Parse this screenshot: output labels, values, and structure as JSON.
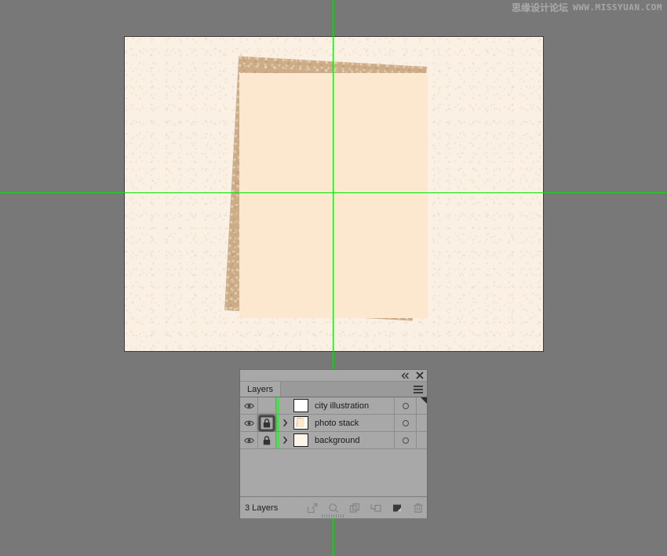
{
  "watermark": {
    "chinese": "思缘设计论坛",
    "url": "WWW.MISSYUAN.COM"
  },
  "canvas": {
    "background_color": "#fbf0e4",
    "back_sheet_color": "#cdad87",
    "front_sheet_color": "#fce8ce",
    "guide_color": "#00e800",
    "workspace_color": "#787878"
  },
  "panel": {
    "titlebar": {
      "collapse_icon": "double-chevron-left-icon",
      "close_icon": "close-icon"
    },
    "tab_label": "Layers",
    "menu_icon": "hamburger-menu-icon",
    "footer_count": "3 Layers",
    "footer_buttons": [
      {
        "name": "make-clipping-mask-button",
        "icon": "clipping-mask-icon"
      },
      {
        "name": "locate-object-button",
        "icon": "magnifier-icon"
      },
      {
        "name": "create-new-sublayer-button",
        "icon": "new-sublayer-icon"
      },
      {
        "name": "create-new-sublayer-alt-button",
        "icon": "new-sublayer-arrow-icon"
      },
      {
        "name": "create-new-layer-button",
        "icon": "new-layer-icon"
      },
      {
        "name": "delete-selection-button",
        "icon": "trash-icon"
      }
    ],
    "layers": [
      {
        "name": "city illustration",
        "visible": true,
        "locked": false,
        "has_lock_icon": false,
        "expandable": false,
        "color": "#4cdd4c",
        "thumbnail": "blank-white",
        "selected_corner": true,
        "target_state": "unselected",
        "lock_highlighted": false
      },
      {
        "name": "photo stack",
        "visible": true,
        "locked": true,
        "has_lock_icon": true,
        "expandable": true,
        "color": "#4cdd4c",
        "thumbnail": "photo-stack",
        "selected_corner": false,
        "target_state": "unselected",
        "lock_highlighted": true
      },
      {
        "name": "background",
        "visible": true,
        "locked": true,
        "has_lock_icon": true,
        "expandable": true,
        "color": "#4cdd4c",
        "thumbnail": "cream-background",
        "selected_corner": false,
        "target_state": "unselected",
        "lock_highlighted": false
      }
    ]
  }
}
